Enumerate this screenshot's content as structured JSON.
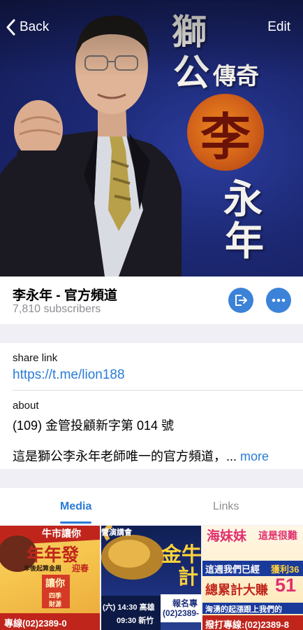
{
  "nav": {
    "back_label": "Back",
    "edit_label": "Edit"
  },
  "hero": {
    "calligraphy": {
      "line1": "獅",
      "line2": "公",
      "line3": "傳奇",
      "seal": "李",
      "line4": "永",
      "line5": "年"
    }
  },
  "channel": {
    "name": "李永年 - 官方頻道",
    "subscribers": "7,810 subscribers"
  },
  "info": {
    "share_link_label": "share link",
    "share_link_url": "https://t.me/lion188",
    "about_label": "about",
    "about_line1": "(109) 金管投顧新字第 014 號",
    "about_line2": "這是獅公李永年老師唯一的官方頻道，...",
    "more_label": "more"
  },
  "tabs": [
    {
      "label": "Media",
      "active": true
    },
    {
      "label": "Links",
      "active": false
    }
  ],
  "media": [
    {
      "texts": [
        "牛市讓你",
        "年年發",
        "年後起算金周",
        "迎春",
        "讓你",
        "四季",
        "財源",
        "專線(02)2389-0"
      ]
    },
    {
      "texts": [
        "營演講會",
        "金牛",
        "計",
        "(六) 14:30 高雄",
        "09:30 新竹",
        "報名專",
        "(02)2389-"
      ]
    },
    {
      "texts": [
        "海妹妹",
        "這是很難",
        "這週我們已經",
        "獲利36",
        "總累計大賺",
        "51",
        "洶湧的起漲跟上我們的",
        "撥打專線:(02)2389-8"
      ]
    }
  ],
  "colors": {
    "accent": "#2a7bd6",
    "button": "#3b82d8",
    "hero_bg": "#1c2873",
    "seal": "#d0601a"
  }
}
